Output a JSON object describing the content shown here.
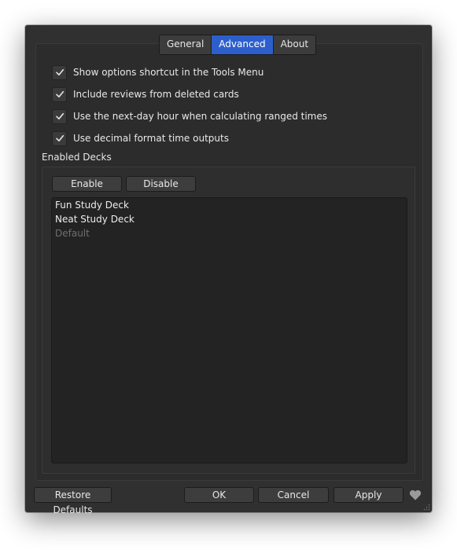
{
  "tabs": [
    {
      "label": "General",
      "active": false
    },
    {
      "label": "Advanced",
      "active": true
    },
    {
      "label": "About",
      "active": false
    }
  ],
  "options": [
    {
      "label": "Show options shortcut in the Tools Menu",
      "checked": true
    },
    {
      "label": "Include reviews from deleted cards",
      "checked": true
    },
    {
      "label": "Use the next-day hour when calculating ranged times",
      "checked": true
    },
    {
      "label": "Use decimal format time outputs",
      "checked": true
    }
  ],
  "enabled_decks": {
    "title": "Enabled Decks",
    "enable_label": "Enable",
    "disable_label": "Disable",
    "decks": [
      {
        "name": "Fun Study Deck",
        "enabled": true
      },
      {
        "name": "Neat Study Deck",
        "enabled": true
      },
      {
        "name": "Default",
        "enabled": false
      }
    ]
  },
  "footer": {
    "restore_label": "Restore Defaults",
    "ok_label": "OK",
    "cancel_label": "Cancel",
    "apply_label": "Apply"
  },
  "colors": {
    "window_bg": "#303030",
    "accent": "#2d5fcc",
    "list_bg": "#232323",
    "disabled_text": "#6f6f6f"
  },
  "icons": {
    "check": "check-icon",
    "support": "heart-icon"
  }
}
